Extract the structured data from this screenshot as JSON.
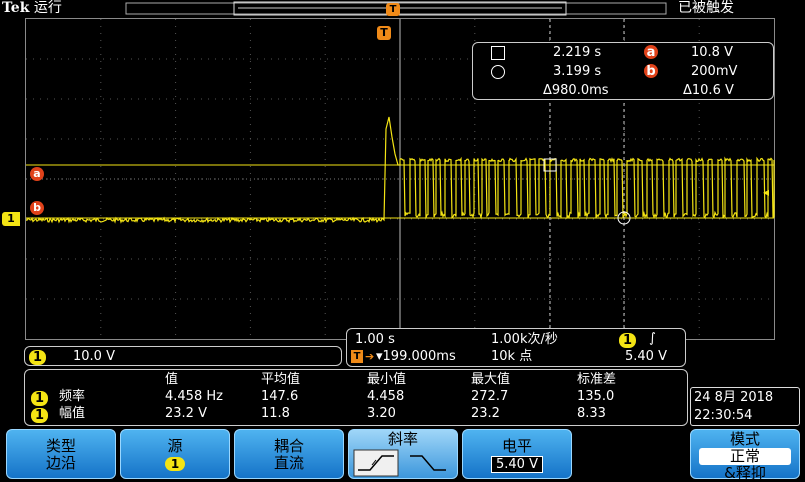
{
  "topbar": {
    "brand": "Tek",
    "run_state": "运行",
    "trigger_state": "已被触发"
  },
  "markers": {
    "trigger_marker": "T",
    "cursor_a": "a",
    "cursor_b": "b",
    "channel": "1"
  },
  "cursors": {
    "row1": {
      "t": "2.219 s",
      "v": "10.8 V"
    },
    "row2": {
      "t": "3.199 s",
      "v": "200mV"
    },
    "row3": {
      "dt": "Δ980.0ms",
      "dv": "Δ10.6 V"
    }
  },
  "channel_scale": {
    "ch": "1",
    "value": "10.0 V"
  },
  "timebase": {
    "per_div": "1.00 s",
    "sample_rate": "1.00k次/秒",
    "trig_pos": "▾199.000ms",
    "record": "10k 点",
    "trig_ch": "1",
    "trig_level": "5.40 V"
  },
  "measurements": {
    "headers": [
      "值",
      "平均值",
      "最小值",
      "最大值",
      "标准差"
    ],
    "rows": [
      {
        "ch": "1",
        "name": "频率",
        "values": [
          "4.458 Hz",
          "147.6",
          "4.458",
          "272.7",
          "135.0"
        ]
      },
      {
        "ch": "1",
        "name": "幅值",
        "values": [
          "23.2 V",
          "11.8",
          "3.20",
          "23.2",
          "8.33"
        ]
      }
    ]
  },
  "datetime": {
    "date": "24 8月  2018",
    "time": "22:30:54"
  },
  "softkeys": {
    "type": {
      "label": "类型",
      "value": "边沿"
    },
    "source": {
      "label": "源",
      "value": "1"
    },
    "coupling": {
      "label": "耦合",
      "value": "直流"
    },
    "slope": {
      "label": "斜率"
    },
    "level": {
      "label": "电平",
      "value": "5.40 V"
    },
    "mode": {
      "label": "模式",
      "value1": "正常",
      "value2": "&释抑"
    }
  },
  "colors": {
    "trace": "#f4e414",
    "cursor_badge": "#e0421a",
    "softkey": "#2b8ee0"
  }
}
